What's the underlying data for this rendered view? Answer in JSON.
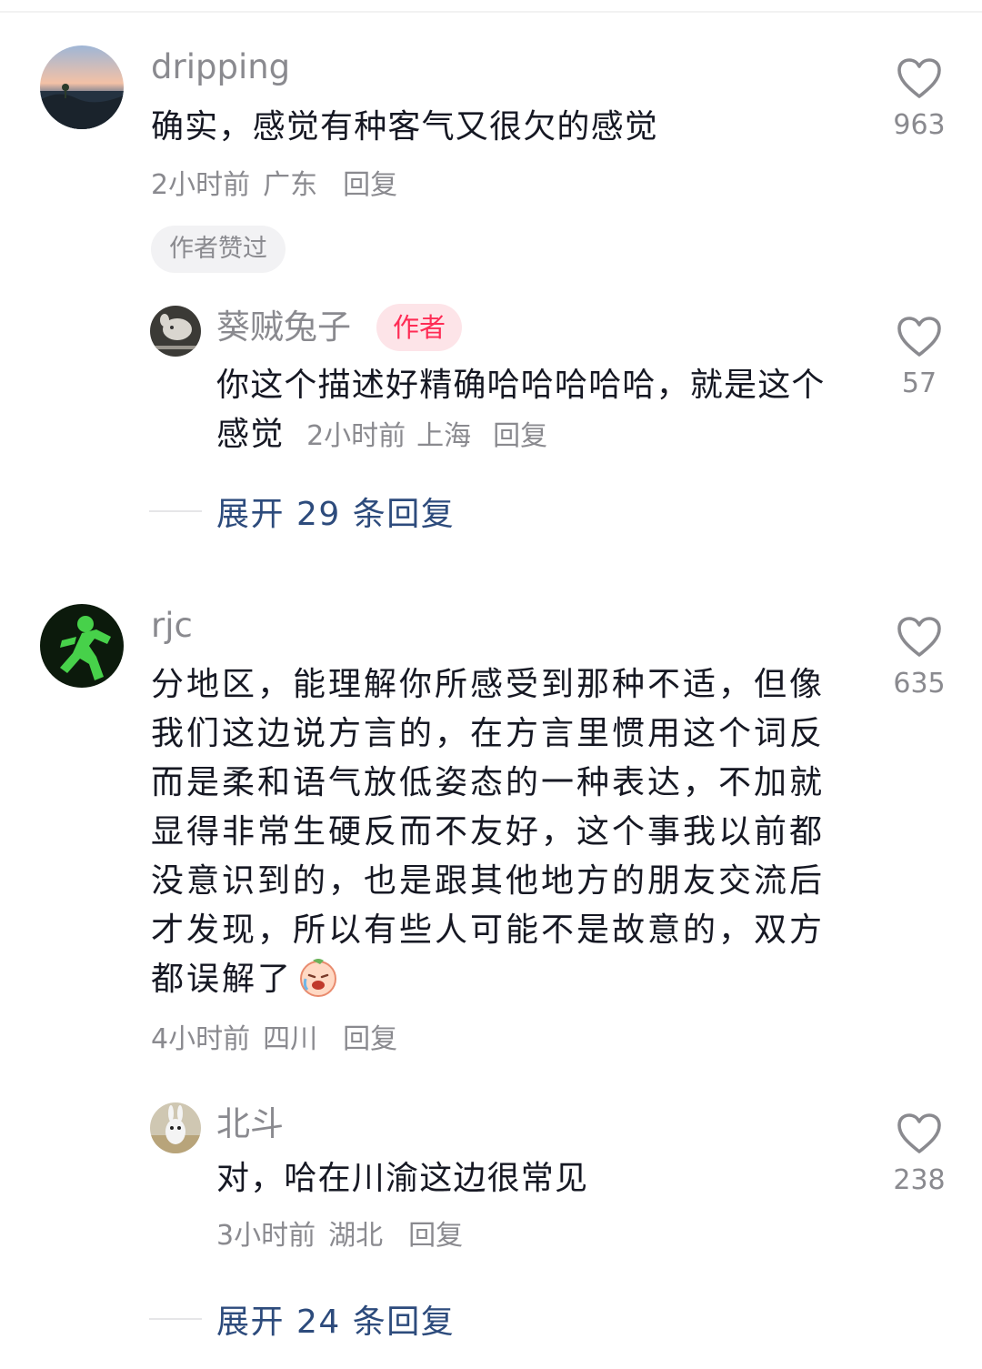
{
  "comments": [
    {
      "username": "dripping",
      "text": "确实，感觉有种客气又很欠的感觉",
      "time": "2小时前",
      "location": "广东",
      "reply_label": "回复",
      "author_liked": "作者赞过",
      "likes": "963",
      "sub_reply": {
        "username": "葵贼兔子",
        "author_tag": "作者",
        "text": "你这个描述好精确哈哈哈哈哈，就是这个感觉",
        "time": "2小时前",
        "location": "上海",
        "reply_label": "回复",
        "likes": "57"
      },
      "expand_label": "展开 29 条回复"
    },
    {
      "username": "rjc",
      "text": "分地区，能理解你所感受到那种不适，但像我们这边说方言的，在方言里惯用这个词反而是柔和语气放低姿态的一种表达，不加就显得非常生硬反而不友好，这个事我以前都没意识到的，也是跟其他地方的朋友交流后才发现，所以有些人可能不是故意的，双方都误解了",
      "time": "4小时前",
      "location": "四川",
      "reply_label": "回复",
      "likes": "635",
      "sub_reply": {
        "username": "北斗",
        "text": "对，哈在川渝这边很常见",
        "time": "3小时前",
        "location": "湖北",
        "reply_label": "回复",
        "likes": "238"
      },
      "expand_label": "展开 24 条回复"
    }
  ],
  "icons": {
    "like": "heart-outline-icon",
    "emoji": "crying-face-emoji-icon"
  },
  "colors": {
    "author_tag_bg": "#fde4e8",
    "author_tag_text": "#fe2c55",
    "expand_link": "#2d4b7c",
    "meta_gray": "#8a8a8f"
  }
}
